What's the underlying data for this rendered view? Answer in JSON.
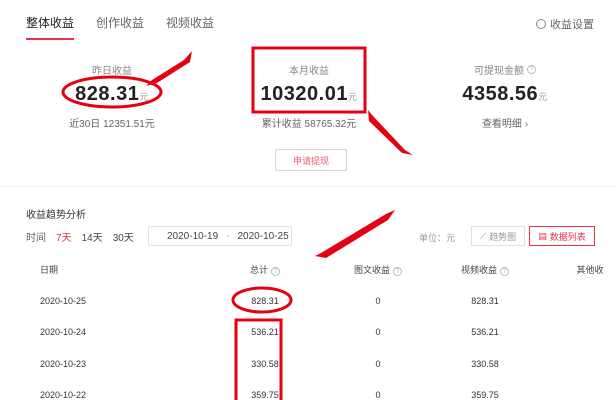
{
  "tabs": [
    "整体收益",
    "创作收益",
    "视频收益"
  ],
  "settings_label": "收益设置",
  "stats": [
    {
      "label": "昨日收益",
      "value": "828.31",
      "unit": "元",
      "sub": "近30日 12351.51元",
      "has_help": false
    },
    {
      "label": "本月收益",
      "value": "10320.01",
      "unit": "元",
      "sub": "累计收益 58765.32元",
      "has_help": false
    },
    {
      "label": "可提现金额",
      "value": "4358.56",
      "unit": "元",
      "sub": "查看明细 ›",
      "has_help": true
    }
  ],
  "withdraw_label": "申请提现",
  "trend": {
    "title": "收益趋势分析",
    "time_label": "时间",
    "ranges": [
      "7天",
      "14天",
      "30天"
    ],
    "selected_range": "7天",
    "date_start": "2020-10-19",
    "date_end": "2020-10-25",
    "date_sep": "-",
    "unit_label": "单位：元",
    "chart_view_label": "趋势图",
    "list_view_label": "数据列表"
  },
  "table": {
    "headers": [
      "日期",
      "总计",
      "图文收益",
      "视频收益",
      "其他收"
    ],
    "rows": [
      [
        "2020-10-25",
        "828.31",
        "0",
        "828.31"
      ],
      [
        "2020-10-24",
        "536.21",
        "0",
        "536.21"
      ],
      [
        "2020-10-23",
        "330.58",
        "0",
        "330.58"
      ],
      [
        "2020-10-22",
        "359.75",
        "0",
        "359.75"
      ]
    ]
  },
  "colors": {
    "accent": "#e8334a",
    "annotation": "#e60012"
  }
}
